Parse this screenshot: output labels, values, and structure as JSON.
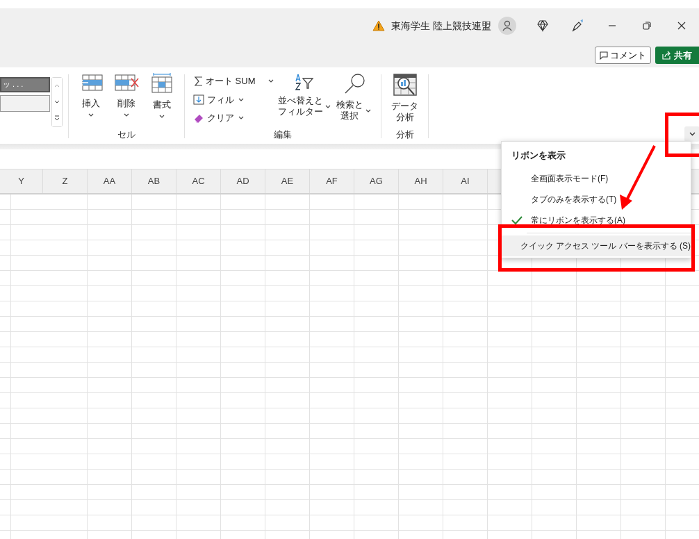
{
  "title_bar": {
    "account_warning": true,
    "account_name": "東海学生 陸上競技連盟",
    "comment_button": "コメント",
    "share_button": "共有"
  },
  "ribbon": {
    "gallery_preview": "ッ . . .",
    "groups": [
      {
        "label": "セル",
        "kind": "large",
        "buttons": [
          {
            "lines": [
              "挿入"
            ],
            "caret": true
          },
          {
            "lines": [
              "削除"
            ],
            "caret": true
          },
          {
            "lines": [
              "書式"
            ],
            "caret": true
          }
        ]
      },
      {
        "label": "編集",
        "kind": "edit",
        "small": [
          {
            "label": "オート SUM",
            "caret": true
          },
          {
            "label": "フィル",
            "caret": true
          },
          {
            "label": "クリア",
            "caret": true
          }
        ],
        "buttons": [
          {
            "lines": [
              "並べ替えと",
              "フィルター"
            ],
            "caret": true
          },
          {
            "lines": [
              "検索と",
              "選択"
            ],
            "caret": true
          }
        ]
      },
      {
        "label": "分析",
        "kind": "large",
        "buttons": [
          {
            "lines": [
              "データ",
              "分析"
            ],
            "caret": false
          }
        ]
      }
    ]
  },
  "columns": [
    "Y",
    "Z",
    "AA",
    "AB",
    "AC",
    "AD",
    "AE",
    "AF",
    "AG",
    "AH",
    "AI"
  ],
  "ribbon_menu": {
    "title": "リボンを表示",
    "items": [
      {
        "label": "全画面表示モード(F)",
        "checked": false,
        "highlighted": false
      },
      {
        "label": "タブのみを表示する(T)",
        "checked": false,
        "highlighted": false
      },
      {
        "label": "常にリボンを表示する(A)",
        "checked": true,
        "highlighted": false
      },
      {
        "label": "クイック アクセス ツール バーを表示する (S)",
        "checked": false,
        "highlighted": true
      }
    ]
  }
}
